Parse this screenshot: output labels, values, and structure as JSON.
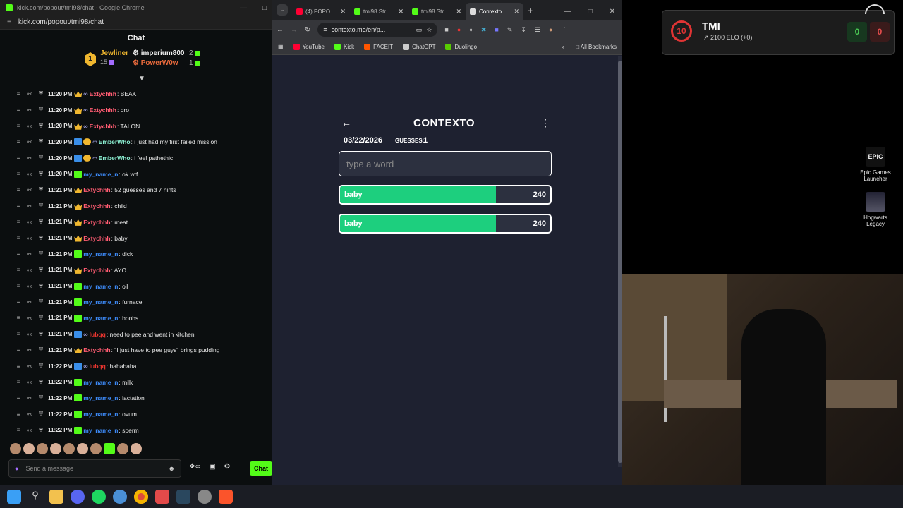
{
  "chat_window": {
    "title": "kick.com/popout/tmi98/chat - Google Chrome",
    "url": "kick.com/popout/tmi98/chat",
    "header": "Chat",
    "pinned": {
      "gifter_name": "Jewliner",
      "gifter_count": "15",
      "gifter_badge": "1",
      "user1_name": "imperium800",
      "user1_count": "2",
      "user2_name": "PowerW0w",
      "user2_count": "1"
    },
    "messages": [
      {
        "time": "11:20 PM",
        "badges": [
          "crown",
          "inf"
        ],
        "user": "Extychhh",
        "color": "#ff5c72",
        "text": ": BEAK"
      },
      {
        "time": "11:20 PM",
        "badges": [
          "crown",
          "inf"
        ],
        "user": "Extychhh",
        "color": "#ff5c72",
        "text": ": bro"
      },
      {
        "time": "11:20 PM",
        "badges": [
          "crown",
          "inf"
        ],
        "user": "Extychhh",
        "color": "#ff5c72",
        "text": ": TALON"
      },
      {
        "time": "11:20 PM",
        "badges": [
          "blue",
          "gold",
          "inf"
        ],
        "user": "EmberWho",
        "color": "#8df2d4",
        "text": ": i just had my first failed mission"
      },
      {
        "time": "11:20 PM",
        "badges": [
          "blue",
          "gold",
          "inf"
        ],
        "user": "EmberWho",
        "color": "#8df2d4",
        "text": ": i feel pathethic"
      },
      {
        "time": "11:20 PM",
        "badges": [
          "gift"
        ],
        "user": "my_name_n",
        "color": "#3d8af7",
        "text": ": ok wtf"
      },
      {
        "time": "11:21 PM",
        "badges": [
          "crown"
        ],
        "user": "Extychhh",
        "color": "#ff5c72",
        "text": ": 52 guesses and 7 hints"
      },
      {
        "time": "11:21 PM",
        "badges": [
          "crown"
        ],
        "user": "Extychhh",
        "color": "#ff5c72",
        "text": ": child"
      },
      {
        "time": "11:21 PM",
        "badges": [
          "crown"
        ],
        "user": "Extychhh",
        "color": "#ff5c72",
        "text": ": meat"
      },
      {
        "time": "11:21 PM",
        "badges": [
          "crown"
        ],
        "user": "Extychhh",
        "color": "#ff5c72",
        "text": ": baby"
      },
      {
        "time": "11:21 PM",
        "badges": [
          "gift"
        ],
        "user": "my_name_n",
        "color": "#3d8af7",
        "text": ": dick"
      },
      {
        "time": "11:21 PM",
        "badges": [
          "crown"
        ],
        "user": "Extychhh",
        "color": "#ff5c72",
        "text": ": AYO"
      },
      {
        "time": "11:21 PM",
        "badges": [
          "gift"
        ],
        "user": "my_name_n",
        "color": "#3d8af7",
        "text": ": oil"
      },
      {
        "time": "11:21 PM",
        "badges": [
          "gift"
        ],
        "user": "my_name_n",
        "color": "#3d8af7",
        "text": ": furnace"
      },
      {
        "time": "11:21 PM",
        "badges": [
          "gift"
        ],
        "user": "my_name_n",
        "color": "#3d8af7",
        "text": ": boobs"
      },
      {
        "time": "11:21 PM",
        "badges": [
          "blue",
          "inf"
        ],
        "user": "lubqq",
        "color": "#e8352f",
        "text": ": need to pee and went in kitchen"
      },
      {
        "time": "11:21 PM",
        "badges": [
          "crown"
        ],
        "user": "Extychhh",
        "color": "#ff5c72",
        "text": ": \"I just have to pee guys\" brings pudding"
      },
      {
        "time": "11:22 PM",
        "badges": [
          "blue",
          "inf"
        ],
        "user": "lubqq",
        "color": "#e8352f",
        "text": ": hahahaha"
      },
      {
        "time": "11:22 PM",
        "badges": [
          "gift"
        ],
        "user": "my_name_n",
        "color": "#3d8af7",
        "text": ": milk"
      },
      {
        "time": "11:22 PM",
        "badges": [
          "gift"
        ],
        "user": "my_name_n",
        "color": "#3d8af7",
        "text": ": lactation"
      },
      {
        "time": "11:22 PM",
        "badges": [
          "gift"
        ],
        "user": "my_name_n",
        "color": "#3d8af7",
        "text": ": ovum"
      },
      {
        "time": "11:22 PM",
        "badges": [
          "gift"
        ],
        "user": "my_name_n",
        "color": "#3d8af7",
        "text": ": sperm"
      }
    ],
    "send_placeholder": "Send a message",
    "chat_button": "Chat"
  },
  "browser": {
    "tabs": [
      {
        "label": "(4) POPO",
        "icon": "youtube-icon",
        "color": "#ff0033",
        "active": false
      },
      {
        "label": "tmi98 Str",
        "icon": "kick-icon",
        "color": "#53fc18",
        "active": false
      },
      {
        "label": "tmi98 Str",
        "icon": "kick-icon",
        "color": "#53fc18",
        "active": false
      },
      {
        "label": "Contexto",
        "icon": "contexto-icon",
        "color": "#dddddd",
        "active": true
      }
    ],
    "url": "contexto.me/en/p...",
    "bookmarks": [
      {
        "label": "YouTube",
        "color": "#ff0033"
      },
      {
        "label": "Kick",
        "color": "#53fc18"
      },
      {
        "label": "FACEIT",
        "color": "#ff5500"
      },
      {
        "label": "ChatGPT",
        "color": "#cccccc"
      },
      {
        "label": "Duolingo",
        "color": "#58cc02"
      }
    ],
    "all_bookmarks": "All Bookmarks"
  },
  "contexto": {
    "title": "CONTEXTO",
    "date": "03/22/2026",
    "guesses_label": "GUESSES:",
    "guesses_count": "1",
    "input_placeholder": "type a word",
    "rows": [
      {
        "word": "baby",
        "rank": "240",
        "fill": 0.74
      },
      {
        "word": "baby",
        "rank": "240",
        "fill": 0.74
      }
    ]
  },
  "overlay": {
    "level": "10",
    "name": "TMI",
    "elo": "2100 ELO (+0)",
    "score_left": "0",
    "score_right": "0"
  },
  "desktop_icons": [
    {
      "label": "Epic Games Launcher",
      "logo": "EPIC"
    },
    {
      "label": "Hogwarts Legacy"
    }
  ]
}
